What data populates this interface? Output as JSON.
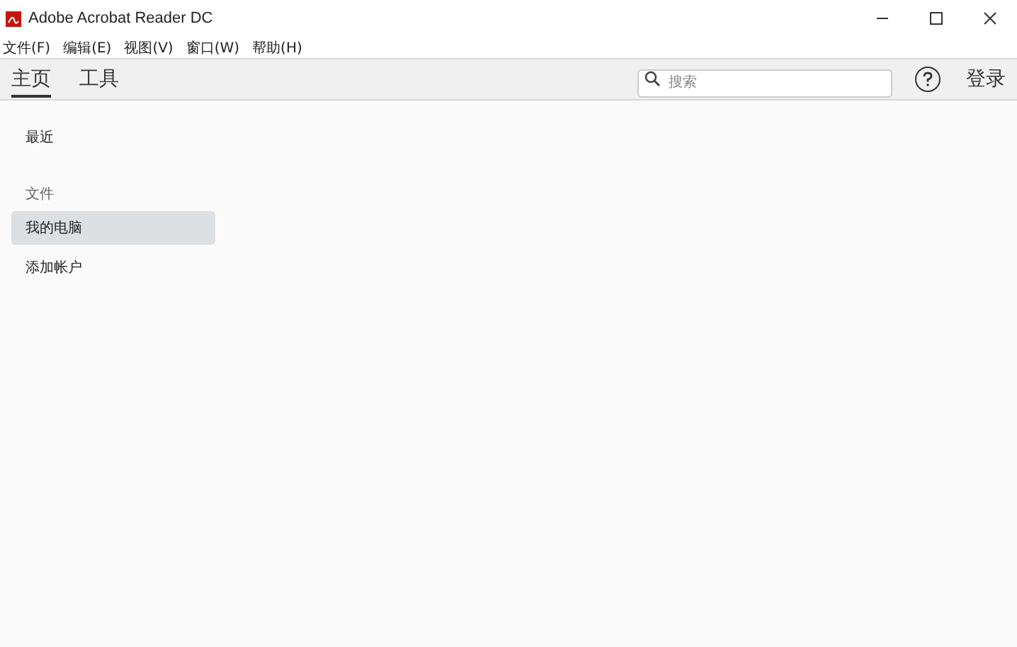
{
  "window": {
    "title": "Adobe Acrobat Reader DC"
  },
  "menu": [
    "文件(F)",
    "编辑(E)",
    "视图(V)",
    "窗口(W)",
    "帮助(H)"
  ],
  "tabs": [
    {
      "label": "主页",
      "selected": true
    },
    {
      "label": "工具",
      "selected": false
    }
  ],
  "search": {
    "placeholder": "搜索"
  },
  "sign_in": "登录",
  "sidebar": {
    "items": [
      {
        "kind": "link",
        "label": "最近",
        "selected": false
      },
      {
        "kind": "heading",
        "label": "文件",
        "selected": false
      },
      {
        "kind": "link",
        "label": "我的电脑",
        "selected": true
      },
      {
        "kind": "link",
        "label": "添加帐户",
        "selected": false
      }
    ]
  }
}
